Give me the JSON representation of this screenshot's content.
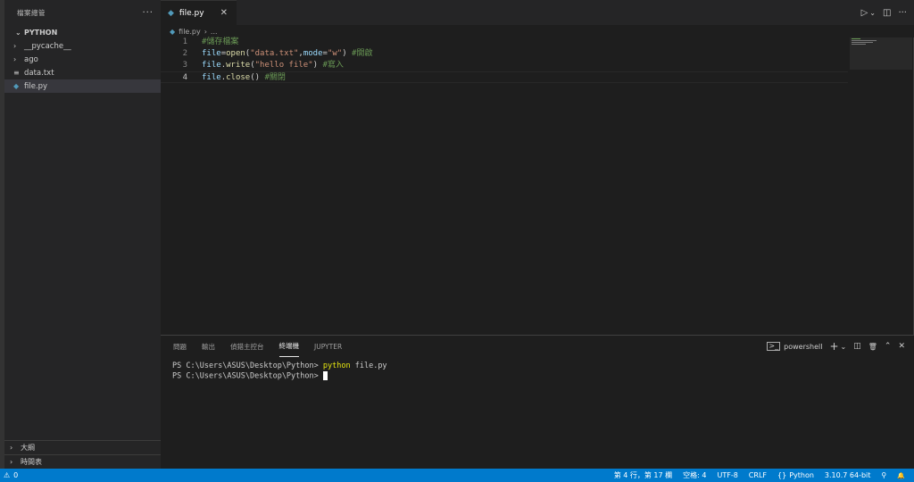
{
  "sidebar": {
    "title": "檔案總管",
    "more": "···",
    "section": "PYTHON",
    "items": [
      {
        "label": "__pycache__",
        "chevron": "›",
        "icon": "",
        "type": "folder"
      },
      {
        "label": "ago",
        "chevron": "›",
        "icon": "",
        "type": "folder"
      },
      {
        "label": "data.txt",
        "chevron": "",
        "icon": "≡",
        "type": "txt"
      },
      {
        "label": "file.py",
        "chevron": "",
        "icon": "◆",
        "type": "py"
      }
    ],
    "outline_label": "大綱",
    "timeline_label": "時間表",
    "section_chevron": "›"
  },
  "editor": {
    "tab_label": "file.py",
    "tab_close": "✕",
    "breadcrumb_file": "file.py",
    "breadcrumb_sep": "›",
    "breadcrumb_more": "...",
    "run_icon": "▷",
    "run_menu": "⌄",
    "split_icon": "◫",
    "more_icon": "···",
    "lines": [
      {
        "n": "1",
        "tokens": [
          {
            "t": "#儲存檔案",
            "c": "cm"
          }
        ]
      },
      {
        "n": "2",
        "tokens": [
          {
            "t": "file",
            "c": "var"
          },
          {
            "t": "=",
            "c": "op"
          },
          {
            "t": "open",
            "c": "fn"
          },
          {
            "t": "(",
            "c": "op"
          },
          {
            "t": "\"data.txt\"",
            "c": "str"
          },
          {
            "t": ",",
            "c": "op"
          },
          {
            "t": "mode",
            "c": "var"
          },
          {
            "t": "=",
            "c": "op"
          },
          {
            "t": "\"w\"",
            "c": "str"
          },
          {
            "t": ") ",
            "c": "op"
          },
          {
            "t": "#開啟",
            "c": "cm"
          }
        ]
      },
      {
        "n": "3",
        "tokens": [
          {
            "t": "file",
            "c": "var"
          },
          {
            "t": ".",
            "c": "op"
          },
          {
            "t": "write",
            "c": "fn"
          },
          {
            "t": "(",
            "c": "op"
          },
          {
            "t": "\"hello file\"",
            "c": "str"
          },
          {
            "t": ") ",
            "c": "op"
          },
          {
            "t": "#寫入",
            "c": "cm"
          }
        ]
      },
      {
        "n": "4",
        "tokens": [
          {
            "t": "file",
            "c": "var"
          },
          {
            "t": ".",
            "c": "op"
          },
          {
            "t": "close",
            "c": "fn"
          },
          {
            "t": "() ",
            "c": "op"
          },
          {
            "t": "#關閉",
            "c": "cm"
          }
        ]
      }
    ]
  },
  "panel": {
    "tabs": [
      "問題",
      "輸出",
      "偵錯主控台",
      "終端機",
      "JUPYTER"
    ],
    "active_tab": 3,
    "shell_label": "powershell",
    "add_icon": "+",
    "add_menu": "⌄",
    "split_icon": "◫",
    "trash_icon": "🗑",
    "maximize_icon": "⌃",
    "close_icon": "✕",
    "terminal": {
      "prompt": "PS C:\\Users\\ASUS\\Desktop\\Python> ",
      "command_keyword": "python",
      "command_args": " file.py"
    }
  },
  "status": {
    "problems_icon": "⚠",
    "problems_count": "0",
    "position": "第 4 行，第 17 欄",
    "spaces": "空格: 4",
    "encoding": "UTF-8",
    "eol": "CRLF",
    "language_icon": "{}",
    "language": "Python",
    "interpreter": "3.10.7 64-bit",
    "feedback_icon": "⚲",
    "bell_icon": "🔔"
  },
  "colors": {
    "accent": "#007acc",
    "comment": "#6a9955",
    "string": "#ce9178",
    "function": "#dcdcaa",
    "variable": "#9cdcfe",
    "python_icon": "#519aba"
  }
}
